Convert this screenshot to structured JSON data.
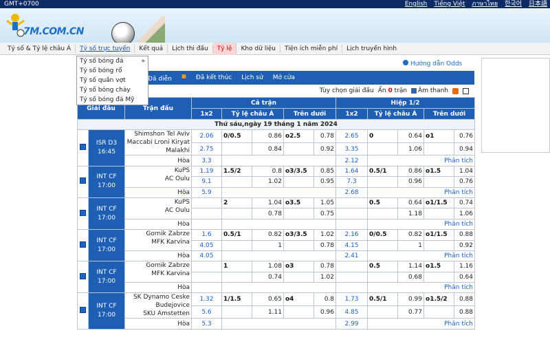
{
  "top": {
    "timezone": "GMT+0700",
    "languages": [
      "English",
      "Tiếng Việt",
      "ภาษาไทย",
      "한국어",
      "日本語"
    ]
  },
  "brand": {
    "logo_text": "7M.COM.CN"
  },
  "nav": [
    "Tỷ số & Tỷ lệ châu Á",
    "Tỷ số trực tuyến",
    "Kết quả",
    "Lịch thi đấu",
    "Tỷ lệ",
    "Kho dữ liệu",
    "Tiện ích miễn phí",
    "Lịch truyền hình"
  ],
  "dropdown": [
    "Tỷ số bóng đá",
    "Tỷ số bóng rổ",
    "Tỷ số quần vợt",
    "Tỷ số bóng chày",
    "Tỷ số bóng đá Mỹ"
  ],
  "guide": "Hướng dẫn Odds",
  "subtabs": [
    "Đã diễn",
    "Đã kết thúc",
    "Lịch sử",
    "Mở cửa"
  ],
  "opts": {
    "choose": "Tùy chọn giải đấu",
    "hidden_label": "Ẩn",
    "hidden_count": "0",
    "hidden_suffix": "trận",
    "sound": "Âm thanh"
  },
  "table": {
    "h_league": "Giải đấu",
    "h_match": "Trận đấu",
    "h_full": "Cả trận",
    "h_half": "Hiệp 1/2",
    "h_1x2": "1x2",
    "h_asia": "Tỷ lệ châu Á",
    "h_ou": "Trên dưới",
    "date": "Thứ sáu,ngày 19 tháng 1 năm 2024",
    "draw": "Hòa",
    "analysis": "Phân tích",
    "matches": [
      {
        "league": "ISR D3",
        "time": "16:45",
        "home": "Shimshon Tel Aviv",
        "away": "Maccabi Lroni Kiryat Malakhi",
        "r1": [
          "2.06",
          "0/0.5",
          "0.86",
          "o2.5",
          "0.78",
          "2.65",
          "0",
          "0.64",
          "o1",
          "0.76"
        ],
        "r2": [
          "2.75",
          "",
          "0.84",
          "",
          "0.92",
          "3.35",
          "",
          "1.06",
          "",
          "0.94"
        ],
        "draw": [
          "3.3",
          "2.12"
        ]
      },
      {
        "league": "INT CF",
        "time": "17:00",
        "home": "KuPS",
        "away": "AC Oulu",
        "r1": [
          "1.19",
          "1.5/2",
          "0.8",
          "o3/3.5",
          "0.85",
          "1.64",
          "0.5/1",
          "0.86",
          "o1.5",
          "1.04"
        ],
        "r2": [
          "9.1",
          "",
          "1.02",
          "",
          "0.95",
          "7.3",
          "",
          "0.96",
          "",
          "0.76"
        ],
        "draw": [
          "5.9",
          "2.68"
        ]
      },
      {
        "league": "INT CF",
        "time": "17:00",
        "home": "KuPS",
        "away": "AC Oulu",
        "r1": [
          "",
          "2",
          "1.04",
          "o3.5",
          "1.05",
          "",
          "0.5",
          "0.64",
          "o1/1.5",
          "0.74"
        ],
        "r2": [
          "",
          "",
          "0.78",
          "",
          "0.75",
          "",
          "",
          "1.18",
          "",
          "1.06"
        ],
        "draw": [
          "",
          ""
        ]
      },
      {
        "league": "INT CF",
        "time": "17:00",
        "home": "Gornik Zabrze",
        "away": "MFK Karvina",
        "r1": [
          "1.6",
          "0.5/1",
          "0.82",
          "o3/3.5",
          "1.02",
          "2.16",
          "0/0.5",
          "0.82",
          "o1/1.5",
          "0.88"
        ],
        "r2": [
          "4.05",
          "",
          "1",
          "",
          "0.78",
          "4.15",
          "",
          "1",
          "",
          "0.92"
        ],
        "draw": [
          "4.05",
          "2.41"
        ]
      },
      {
        "league": "INT CF",
        "time": "17:00",
        "home": "Gornik Zabrze",
        "away": "MFK Karvina",
        "r1": [
          "",
          "1",
          "1.08",
          "o3",
          "0.78",
          "",
          "0.5",
          "1.14",
          "o1.5",
          "1.16"
        ],
        "r2": [
          "",
          "",
          "0.74",
          "",
          "1.02",
          "",
          "",
          "0.68",
          "",
          "0.64"
        ],
        "draw": [
          "",
          ""
        ]
      },
      {
        "league": "INT CF",
        "time": "17:00",
        "home": "SK Dynamo Ceske Budejovice",
        "away": "SKU Amstetten",
        "r1": [
          "1.32",
          "1/1.5",
          "0.65",
          "o4",
          "0.8",
          "1.73",
          "0.5/1",
          "0.99",
          "o1.5/2",
          "0.88"
        ],
        "r2": [
          "5.6",
          "",
          "1.11",
          "",
          "0.96",
          "4.85",
          "",
          "0.77",
          "",
          "0.88"
        ],
        "draw": [
          "5.3",
          "2.99"
        ]
      }
    ]
  },
  "colors": {
    "header": "#1f5fb3",
    "topbar": "#0c2a63"
  }
}
